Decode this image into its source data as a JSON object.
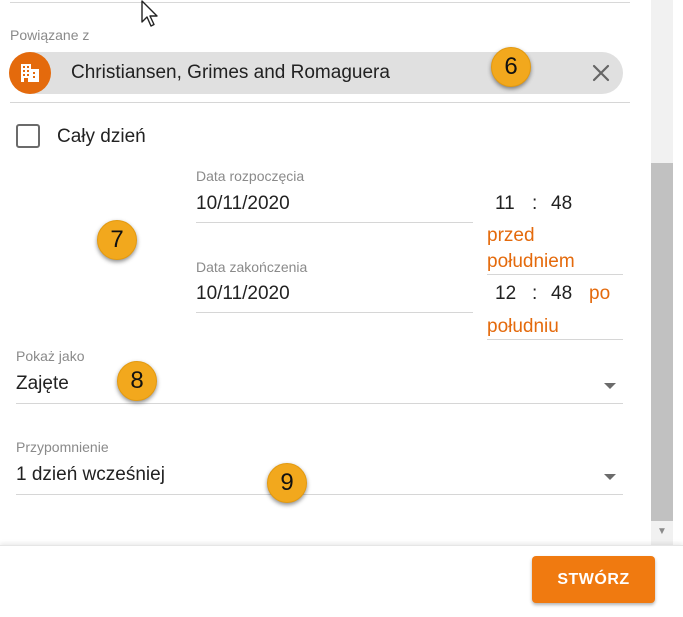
{
  "related": {
    "label": "Powiązane z",
    "chip_text": "Christiansen, Grimes and Romaguera",
    "avatar_icon": "building-icon",
    "close_icon": "close-icon"
  },
  "all_day": {
    "label": "Cały dzień",
    "checked": false
  },
  "start": {
    "label": "Data rozpoczęcia",
    "date": "10/11/2020",
    "hour": "11",
    "separator": ":",
    "minute": "48",
    "ampm_line1": "przed",
    "ampm_line2": "południem"
  },
  "end": {
    "label": "Data zakończenia",
    "date": "10/11/2020",
    "hour": "12",
    "separator": ":",
    "minute": "48",
    "ampm_line1": "po",
    "ampm_line2": "południu"
  },
  "show_as": {
    "label": "Pokaż jako",
    "value": "Zajęte"
  },
  "reminder": {
    "label": "Przypomnienie",
    "value": "1 dzień wcześniej"
  },
  "badges": {
    "b6": "6",
    "b7": "7",
    "b8": "8",
    "b9": "9"
  },
  "footer": {
    "create_label": "STWÓRZ"
  },
  "colors": {
    "accent": "#f07a10",
    "badge": "#f2a81d",
    "chip": "#e0e0e0"
  }
}
